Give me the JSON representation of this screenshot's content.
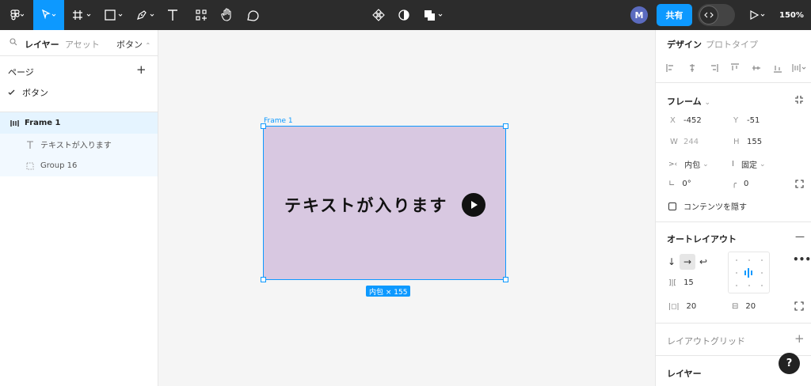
{
  "toolbar": {
    "share_label": "共有",
    "avatar_initial": "M",
    "zoom": "150%"
  },
  "left_panel": {
    "tab_layers": "レイヤー",
    "tab_assets": "アセット",
    "page_selector": "ボタン",
    "pages_header": "ページ",
    "page_item": "ボタン",
    "layers": [
      {
        "label": "Frame 1",
        "icon": "frame-autolayout-icon"
      },
      {
        "label": "テキストが入ります",
        "icon": "text-icon"
      },
      {
        "label": "Group 16",
        "icon": "group-icon"
      }
    ]
  },
  "canvas": {
    "frame_label": "Frame 1",
    "frame_text": "テキストが入ります",
    "size_badge": "内包 × 155",
    "frame_fill": "#d8c8e1",
    "selection_color": "#0d99ff"
  },
  "right_panel": {
    "tab_design": "デザイン",
    "tab_prototype": "プロトタイプ",
    "frame_section": "フレーム",
    "x_label": "X",
    "x_value": "-452",
    "y_label": "Y",
    "y_value": "-51",
    "w_label": "W",
    "w_value": "244",
    "h_label": "H",
    "h_value": "155",
    "width_mode": "内包",
    "height_mode": "固定",
    "rotation": "0°",
    "radius": "0",
    "clip_content": "コンテンツを隠す",
    "autolayout_section": "オートレイアウト",
    "gap": "15",
    "padding_h": "20",
    "padding_v": "20",
    "layout_grid_section": "レイアウトグリッド",
    "layer_section": "レイヤー"
  }
}
